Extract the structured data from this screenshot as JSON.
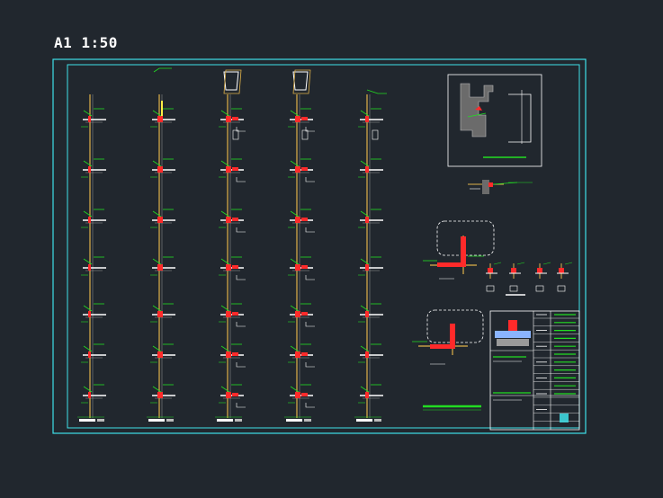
{
  "sheet": {
    "title": "A1 1:50"
  },
  "colors": {
    "background": "#21272e",
    "frame": "#3fe0e8",
    "wall": "#e0b24a",
    "rebar_hot": "#ff2a2a",
    "annotation": "#22dd22",
    "label": "#ffffff",
    "grey": "#9a9a9a"
  },
  "drawing": {
    "section_columns": 5,
    "section_rows": 7,
    "detail_count": 4
  }
}
